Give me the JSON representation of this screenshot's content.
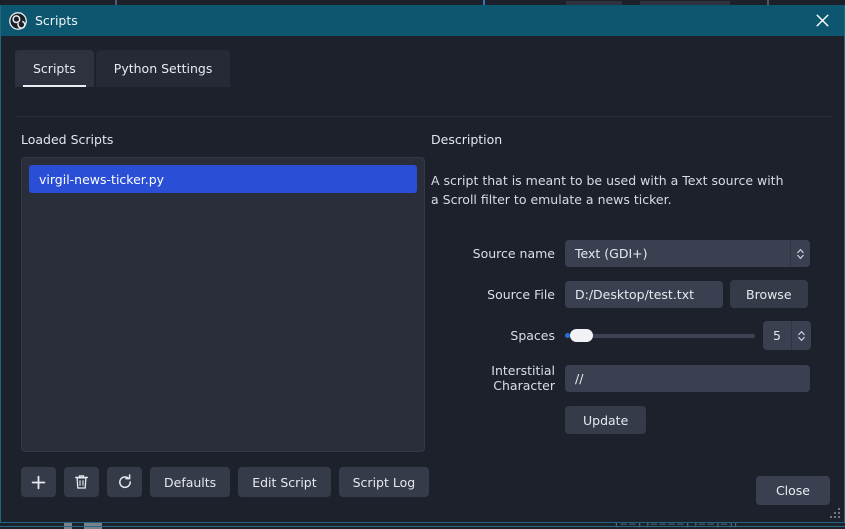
{
  "window": {
    "title": "Scripts",
    "logo_icon": "obs-logo-icon",
    "close_icon": "close-icon"
  },
  "tabs": [
    {
      "label": "Scripts",
      "active": true
    },
    {
      "label": "Python Settings",
      "active": false
    }
  ],
  "left_panel": {
    "heading": "Loaded Scripts",
    "scripts": [
      {
        "name": "virgil-news-ticker.py",
        "selected": true
      }
    ],
    "toolbar": {
      "add_icon": "plus-icon",
      "remove_icon": "trash-icon",
      "reload_icon": "refresh-icon",
      "defaults_label": "Defaults",
      "edit_script_label": "Edit Script",
      "script_log_label": "Script Log"
    }
  },
  "right_panel": {
    "heading": "Description",
    "description": "A script that is meant to be used with a Text source with a Scroll filter to emulate a news ticker.",
    "fields": {
      "source_name": {
        "label": "Source name",
        "value": "Text (GDI+)",
        "arrows_icon": "chevron-updown-icon"
      },
      "source_file": {
        "label": "Source File",
        "value": "D:/Desktop/test.txt",
        "browse_label": "Browse"
      },
      "spaces": {
        "label": "Spaces",
        "value": "5",
        "slider_percent": 3,
        "arrows_icon": "chevron-updown-icon"
      },
      "interstitial": {
        "label": "Interstitial Character",
        "value": "//"
      }
    },
    "update_label": "Update"
  },
  "footer": {
    "close_label": "Close",
    "grip_icon": "resize-grip-icon"
  },
  "background": {
    "taskbar_text": "[==]  ]====]   ]==]=]]"
  },
  "colors": {
    "titlebar": "#0d5670",
    "dialog_bg": "#1d212b",
    "selection_blue": "#2a4fd6",
    "field_bg": "#3b4050",
    "button_bg": "#363b4a",
    "list_bg": "#2a2e3a",
    "border_teal": "#1d6a80",
    "text": "#e5e9ef"
  }
}
